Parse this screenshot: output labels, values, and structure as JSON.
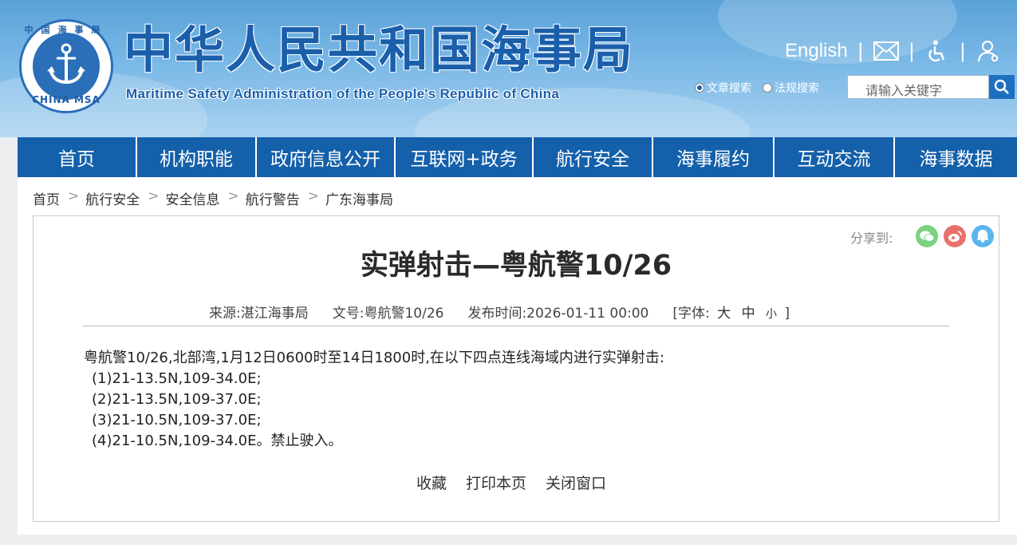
{
  "site": {
    "title_cn": "中华人民共和国海事局",
    "title_en": "Maritime Safety Administration of the People's Republic of China",
    "logo_top_text": "中国海事局",
    "logo_bottom_text": "CHINA MSA"
  },
  "tools": {
    "english_label": "English",
    "sep": "|"
  },
  "search": {
    "option_1": "文章搜索",
    "option_2": "法规搜索",
    "selected": "文章搜索",
    "placeholder": "请输入关键字"
  },
  "nav": {
    "items": [
      {
        "label": "首页"
      },
      {
        "label": "机构职能"
      },
      {
        "label": "政府信息公开"
      },
      {
        "label": "互联网+政务"
      },
      {
        "label": "航行安全"
      },
      {
        "label": "海事履约"
      },
      {
        "label": "互动交流"
      },
      {
        "label": "海事数据"
      }
    ]
  },
  "breadcrumb": {
    "sep": ">",
    "items": [
      "首页",
      "航行安全",
      "安全信息",
      "航行警告",
      "广东海事局"
    ]
  },
  "share": {
    "label": "分享到:"
  },
  "article": {
    "title": "实弹射击—粤航警10/26",
    "source": "来源:湛江海事局",
    "doc_no": "文号:粤航警10/26",
    "published": "发布时间:2026-01-11 00:00",
    "font_label": "[字体:",
    "font_large": "大",
    "font_medium": "中",
    "font_small": "小",
    "font_close": "]",
    "lines": [
      "粤航警10/26,北部湾,1月12日0600时至14日1800时,在以下四点连线海域内进行实弹射击:",
      "(1)21-13.5N,109-34.0E;",
      "(2)21-13.5N,109-37.0E;",
      "(3)21-10.5N,109-37.0E;",
      "(4)21-10.5N,109-34.0E。禁止驶入。"
    ]
  },
  "actions": {
    "favorite": "收藏",
    "print": "打印本页",
    "close": "关闭窗口"
  },
  "colors": {
    "brand_blue": "#1460aa",
    "wechat": "#7bd17f",
    "weibo": "#e8716d",
    "qq": "#5bb6f0"
  }
}
